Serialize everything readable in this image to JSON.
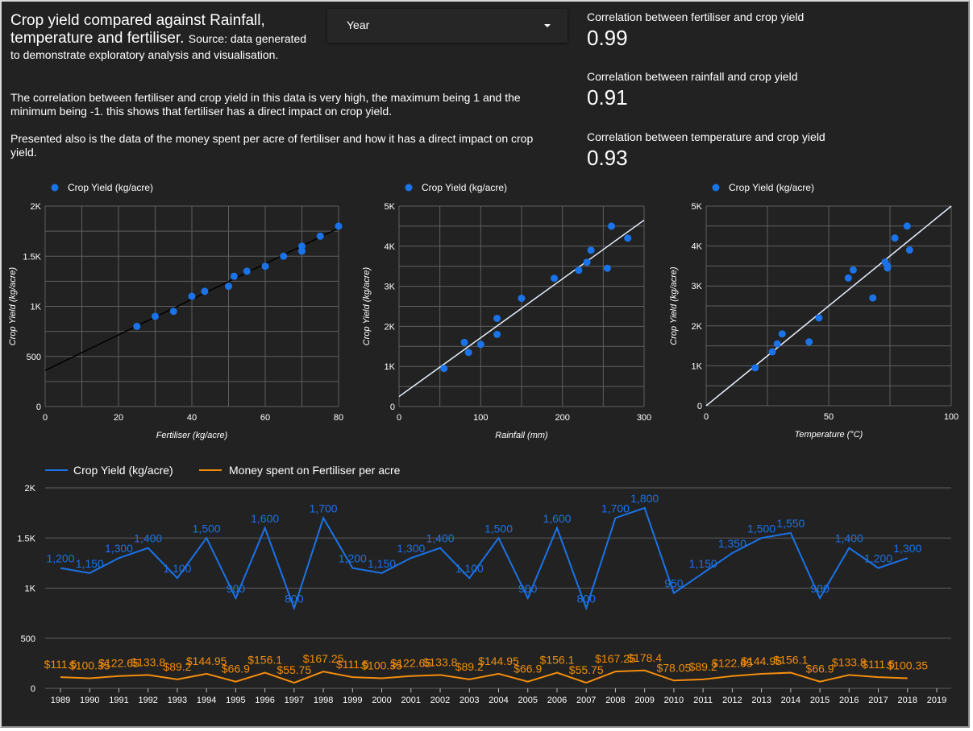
{
  "header": {
    "title_main": "Crop yield compared against Rainfall, temperature and fertiliser.",
    "title_source_1": "Source: data generated",
    "title_source_2": "to demonstrate exploratory analysis and visualisation.",
    "paragraph_1": "The correlation between fertiliser and crop yield in this data is very high, the maximum being 1 and the minimum being -1. this shows that fertiliser has a direct impact on crop yield.",
    "paragraph_2": "Presented also is the data of the money spent per acre of fertiliser and how it has a direct impact on crop yield."
  },
  "filter": {
    "label": "Year"
  },
  "kpis": [
    {
      "label": "Correlation between fertiliser and crop yield",
      "value": "0.99"
    },
    {
      "label": "Correlation between rainfall and crop yield",
      "value": "0.91"
    },
    {
      "label": "Correlation between temperature and crop yield",
      "value": "0.93"
    }
  ],
  "colors": {
    "series_blue": "#1a73e8",
    "series_orange": "#f28d0c",
    "trend_black": "#000000",
    "trend_light": "#e8f0fe",
    "grid": "#5f5f5f",
    "background": "#222222"
  },
  "chart_data": [
    {
      "type": "scatter",
      "legend": [
        "Crop Yield (kg/acre)"
      ],
      "xlabel": "Fertiliser (kg/acre)",
      "ylabel": "Crop Yield (kg/acre)",
      "xlim": [
        0,
        80
      ],
      "ylim": [
        0,
        2000
      ],
      "xticks": [
        0,
        20,
        40,
        60,
        80
      ],
      "xtick_labels": [
        "0",
        "20",
        "40",
        "60",
        "80"
      ],
      "yticks": [
        0,
        500,
        1000,
        1500,
        2000
      ],
      "ytick_labels": [
        "0",
        "500",
        "1K",
        "1.5K",
        "2K"
      ],
      "trendline": {
        "x": [
          0,
          80
        ],
        "y": [
          360,
          1780
        ]
      },
      "points": [
        [
          25,
          800
        ],
        [
          30,
          900
        ],
        [
          35,
          950
        ],
        [
          40,
          1100
        ],
        [
          43.5,
          1150
        ],
        [
          50,
          1200
        ],
        [
          51.5,
          1300
        ],
        [
          55,
          1350
        ],
        [
          60,
          1400
        ],
        [
          65,
          1500
        ],
        [
          70,
          1550
        ],
        [
          70,
          1600
        ],
        [
          75,
          1700
        ],
        [
          80,
          1800
        ]
      ]
    },
    {
      "type": "scatter",
      "legend": [
        "Crop Yield (kg/acre)"
      ],
      "xlabel": "Rainfall (mm)",
      "ylabel": "Crop Yield (kg/acre)",
      "xlim": [
        0,
        300
      ],
      "ylim": [
        0,
        5000
      ],
      "xticks": [
        0,
        100,
        200,
        300
      ],
      "xtick_labels": [
        "0",
        "100",
        "200",
        "300"
      ],
      "yticks": [
        0,
        1000,
        2000,
        3000,
        4000,
        5000
      ],
      "ytick_labels": [
        "0",
        "1K",
        "2K",
        "3K",
        "4K",
        "5K"
      ],
      "trendline": {
        "x": [
          0,
          300
        ],
        "y": [
          250,
          4650
        ]
      },
      "points": [
        [
          55,
          950
        ],
        [
          80,
          1600
        ],
        [
          85,
          1350
        ],
        [
          100,
          1550
        ],
        [
          120,
          1800
        ],
        [
          120,
          2200
        ],
        [
          150,
          2700
        ],
        [
          190,
          3200
        ],
        [
          220,
          3400
        ],
        [
          230,
          3600
        ],
        [
          235,
          3900
        ],
        [
          255,
          3450
        ],
        [
          260,
          4500
        ],
        [
          280,
          4200
        ]
      ]
    },
    {
      "type": "scatter",
      "legend": [
        "Crop Yield (kg/acre)"
      ],
      "xlabel": "Temperature (°C)",
      "ylabel": "Crop Yield (kg/acre)",
      "xlim": [
        0,
        100
      ],
      "ylim": [
        0,
        5000
      ],
      "xticks": [
        0,
        50,
        100
      ],
      "xtick_labels": [
        "0",
        "50",
        "100"
      ],
      "yticks": [
        0,
        1000,
        2000,
        3000,
        4000,
        5000
      ],
      "ytick_labels": [
        "0",
        "1K",
        "2K",
        "3K",
        "4K",
        "5K"
      ],
      "trendline": {
        "x": [
          0,
          100
        ],
        "y": [
          0,
          5000
        ]
      },
      "points": [
        [
          20,
          950
        ],
        [
          27,
          1350
        ],
        [
          29,
          1550
        ],
        [
          31,
          1800
        ],
        [
          42,
          1600
        ],
        [
          46,
          2200
        ],
        [
          58,
          3200
        ],
        [
          60,
          3400
        ],
        [
          68,
          2700
        ],
        [
          73,
          3600
        ],
        [
          74,
          3500
        ],
        [
          74,
          3450
        ],
        [
          77,
          4200
        ],
        [
          82,
          4500
        ],
        [
          83,
          3900
        ]
      ]
    },
    {
      "type": "line",
      "ylim": [
        0,
        2000
      ],
      "yticks": [
        0,
        500,
        1000,
        1500,
        2000
      ],
      "ytick_labels": [
        "0",
        "500",
        "1K",
        "1.5K",
        "2K"
      ],
      "categories": [
        "1989",
        "1990",
        "1991",
        "1992",
        "1993",
        "1994",
        "1995",
        "1996",
        "1997",
        "1998",
        "1999",
        "2000",
        "2001",
        "2002",
        "2003",
        "2004",
        "2005",
        "2006",
        "2007",
        "2008",
        "2009",
        "2010",
        "2011",
        "2012",
        "2013",
        "2014",
        "2015",
        "2016",
        "2017",
        "2018",
        "2019"
      ],
      "series": [
        {
          "name": "Crop Yield (kg/acre)",
          "values": [
            1200,
            1150,
            1300,
            1400,
            1100,
            1500,
            900,
            1600,
            800,
            1700,
            1200,
            1150,
            1300,
            1400,
            1100,
            1500,
            900,
            1600,
            800,
            1700,
            1800,
            950,
            1150,
            1350,
            1500,
            1550,
            900,
            1400,
            1200,
            1300
          ],
          "labels": [
            "1,200",
            "1,150",
            "1,300",
            "1,400",
            "1,100",
            "1,500",
            "900",
            "1,600",
            "800",
            "1,700",
            "1,200",
            "1,150",
            "1,300",
            "1,400",
            "1,100",
            "1,500",
            "900",
            "1,600",
            "800",
            "1,700",
            "1,800",
            "950",
            "1,150",
            "1,350",
            "1,500",
            "1,550",
            "900",
            "1,400",
            "1,200",
            "1,300"
          ]
        },
        {
          "name": "Money spent on Fertiliser per acre",
          "values": [
            111.5,
            100.35,
            122.65,
            133.8,
            89.2,
            144.95,
            66.9,
            156.1,
            55.75,
            167.25,
            111.5,
            100.35,
            122.65,
            133.8,
            89.2,
            144.95,
            66.9,
            156.1,
            55.75,
            167.25,
            178.4,
            78.05,
            89.2,
            122.65,
            144.95,
            156.1,
            66.9,
            133.8,
            111.5,
            100.35
          ],
          "labels": [
            "$111.5",
            "$100.35",
            "$122.65",
            "$133.8",
            "$89.2",
            "$144.95",
            "$66.9",
            "$156.1",
            "$55.75",
            "$167.25",
            "$111.5",
            "$100.35",
            "$122.65",
            "$133.8",
            "$89.2",
            "$144.95",
            "$66.9",
            "$156.1",
            "$55.75",
            "$167.25",
            "$178.4",
            "$78.05",
            "$89.2",
            "$122.65",
            "$144.95",
            "$156.1",
            "$66.9",
            "$133.8",
            "$111.5",
            "$100.35"
          ]
        }
      ]
    }
  ]
}
